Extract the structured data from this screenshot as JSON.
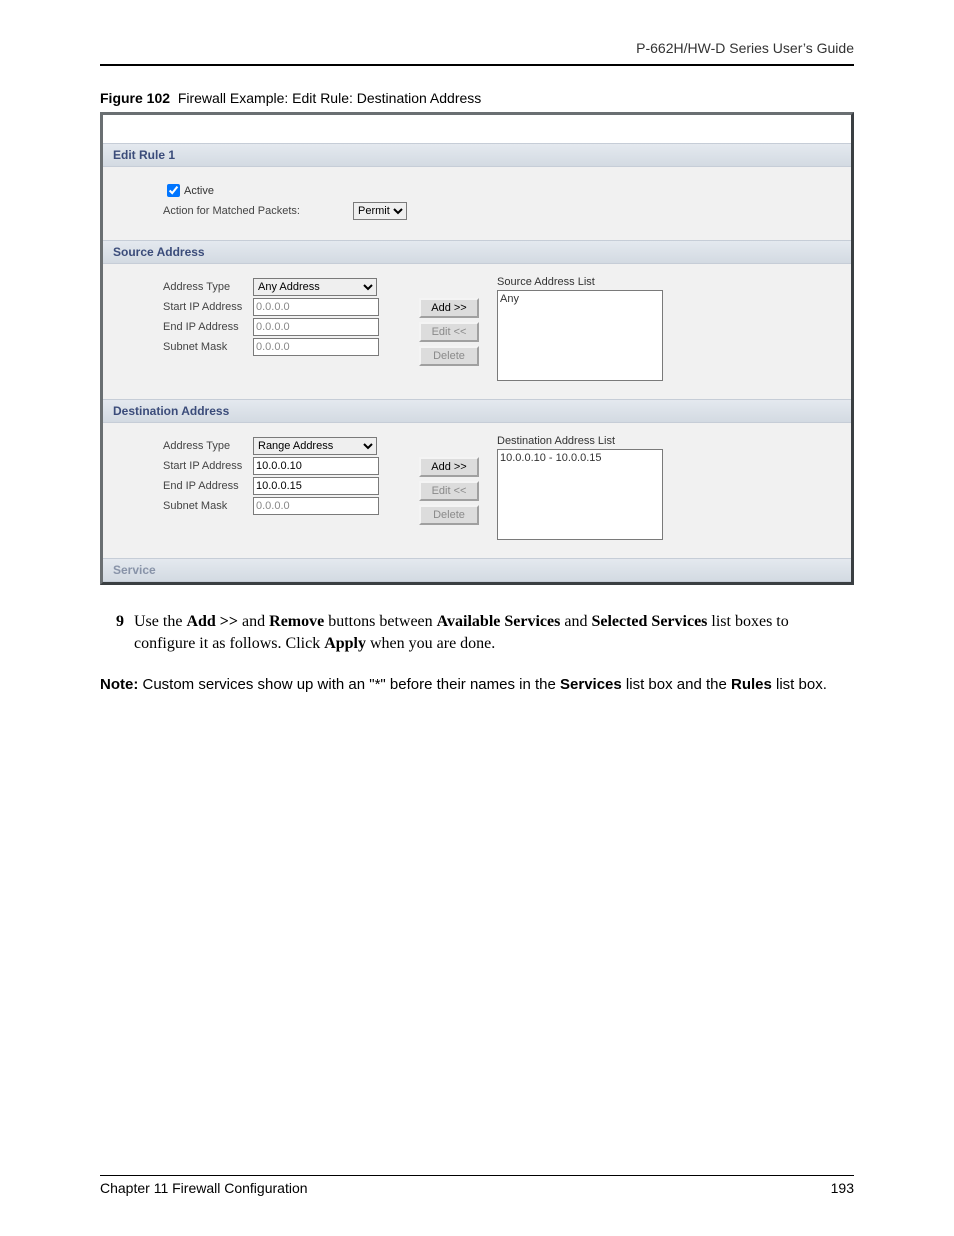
{
  "header": {
    "right": "P-662H/HW-D Series User’s Guide"
  },
  "figure": {
    "label": "Figure 102",
    "caption": "Firewall Example: Edit Rule: Destination Address"
  },
  "shot": {
    "editRule": {
      "title": "Edit Rule 1",
      "activeLabel": "Active",
      "activeChecked": true,
      "actionLabel": "Action for Matched Packets:",
      "actionValue": "Permit"
    },
    "source": {
      "title": "Source Address",
      "addressTypeLabel": "Address Type",
      "addressTypeValue": "Any Address",
      "startIpLabel": "Start IP Address",
      "startIpValue": "0.0.0.0",
      "endIpLabel": "End IP Address",
      "endIpValue": "0.0.0.0",
      "subnetLabel": "Subnet Mask",
      "subnetValue": "0.0.0.0",
      "listTitle": "Source Address List",
      "listItem": "Any"
    },
    "dest": {
      "title": "Destination Address",
      "addressTypeLabel": "Address Type",
      "addressTypeValue": "Range Address",
      "startIpLabel": "Start IP Address",
      "startIpValue": "10.0.0.10",
      "endIpLabel": "End IP Address",
      "endIpValue": "10.0.0.15",
      "subnetLabel": "Subnet Mask",
      "subnetValue": "0.0.0.0",
      "listTitle": "Destination Address List",
      "listItem": "10.0.0.10 - 10.0.0.15"
    },
    "buttons": {
      "add": "Add >>",
      "edit": "Edit <<",
      "delete": "Delete"
    },
    "service": {
      "title": "Service"
    }
  },
  "step9": {
    "num": "9",
    "t1": "Use the ",
    "b1": "Add >>",
    "t2": " and ",
    "b2": "Remove",
    "t3": " buttons between ",
    "b3": "Available Services",
    "t4": " and ",
    "b4": "Selected Services",
    "t5": " list boxes to configure it as follows. Click ",
    "b5": "Apply",
    "t6": " when you are done."
  },
  "note": {
    "b1": "Note:",
    "t1": " Custom services show up with an \"*\" before their names in the ",
    "b2": "Services",
    "t2": " list box and the ",
    "b3": "Rules",
    "t3": " list box."
  },
  "footer": {
    "left": "Chapter 11 Firewall Configuration",
    "right": "193"
  }
}
